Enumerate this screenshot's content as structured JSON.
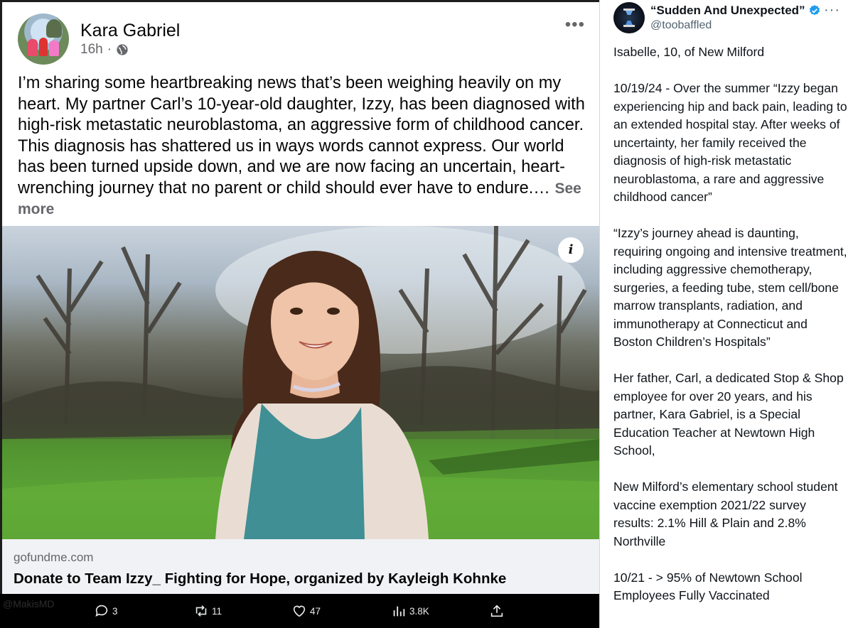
{
  "facebook_post": {
    "author": "Kara Gabriel",
    "time": "16h",
    "separator": "·",
    "body": "I’m sharing some heartbreaking news that’s been weighing heavily on my heart. My partner Carl’s 10-year-old daughter, Izzy, has been diagnosed with high-risk metastatic neuroblastoma, an aggressive form of childhood cancer. This diagnosis has shattered us in ways words cannot express. Our world has been turned upside down, and we are now facing an uncertain, heart-wrenching journey that no parent or child should ever have to endure.…",
    "see_more": "See more",
    "more_icon": "more-horizontal-icon",
    "link_domain": "gofundme.com",
    "link_title": "Donate to Team Izzy_ Fighting for Hope, organized by Kayleigh Kohnke",
    "info_icon_glyph": "i"
  },
  "watermark": "@MakisMD",
  "actions": {
    "replies": "3",
    "reposts": "11",
    "likes": "47",
    "views": "3.8K"
  },
  "tweet": {
    "display_name": "“Sudden And Unexpected”",
    "handle": "@toobaffled",
    "more_glyph": "···",
    "paragraphs": [
      "Isabelle, 10, of New Milford",
      "10/19/24 - Over the summer “Izzy began experiencing hip and back pain, leading to an extended hospital stay. After weeks of uncertainty, her family received the diagnosis of high-risk metastatic neuroblastoma, a rare and aggressive childhood cancer”",
      "“Izzy’s journey ahead is daunting, requiring ongoing and intensive treatment, including aggressive chemotherapy, surgeries, a feeding tube, stem cell/bone marrow transplants, radiation, and immunotherapy at Connecticut and Boston Children’s Hospitals”",
      "Her father, Carl, a dedicated Stop & Shop employee for over 20 years, and his partner, Kara Gabriel, is a Special Education Teacher at Newtown High School,",
      "New Milford’s elementary school student vaccine exemption 2021/22 survey results: 2.1% Hill & Plain and 2.8% Northville",
      "10/21 - > 95% of Newtown School Employees Fully Vaccinated"
    ]
  },
  "colors": {
    "fb_text": "#050505",
    "fb_secondary": "#65676b",
    "x_text": "#0f1419",
    "x_secondary": "#536471",
    "verified_blue": "#1d9bf0"
  }
}
